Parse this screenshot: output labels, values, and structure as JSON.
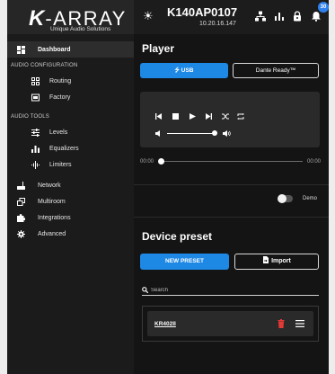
{
  "brand": {
    "logo_k": "K",
    "logo_rest": "-ARRAY",
    "tagline": "Unique Audio Solutions"
  },
  "header": {
    "device_name": "K140AP0107",
    "device_ip": "10.20.16.147",
    "notification_count": "30"
  },
  "sidebar": {
    "dashboard": "Dashboard",
    "section_audio_config": "AUDIO CONFIGURATION",
    "routing": "Routing",
    "factory": "Factory",
    "section_audio_tools": "AUDIO TOOLS",
    "levels": "Levels",
    "equalizers": "Equalizers",
    "limiters": "Limiters",
    "network": "Network",
    "multiroom": "Multiroom",
    "integrations": "Integrations",
    "advanced": "Advanced"
  },
  "player": {
    "title": "Player",
    "usb_label": "USB",
    "dante_label": "Dante Ready™",
    "time_start": "00:00",
    "time_end": "00:00",
    "demo_label": "Demo",
    "volume_level": 0.95,
    "seek_position": 0.0,
    "demo_enabled": false
  },
  "preset": {
    "title": "Device preset",
    "new_label": "NEW PRESET",
    "import_label": "Import",
    "search_placeholder": "Search",
    "items": [
      {
        "name": "KR402II"
      }
    ]
  },
  "colors": {
    "accent": "#1e88e5",
    "delete": "#e53935",
    "badge": "#2f80ed"
  }
}
